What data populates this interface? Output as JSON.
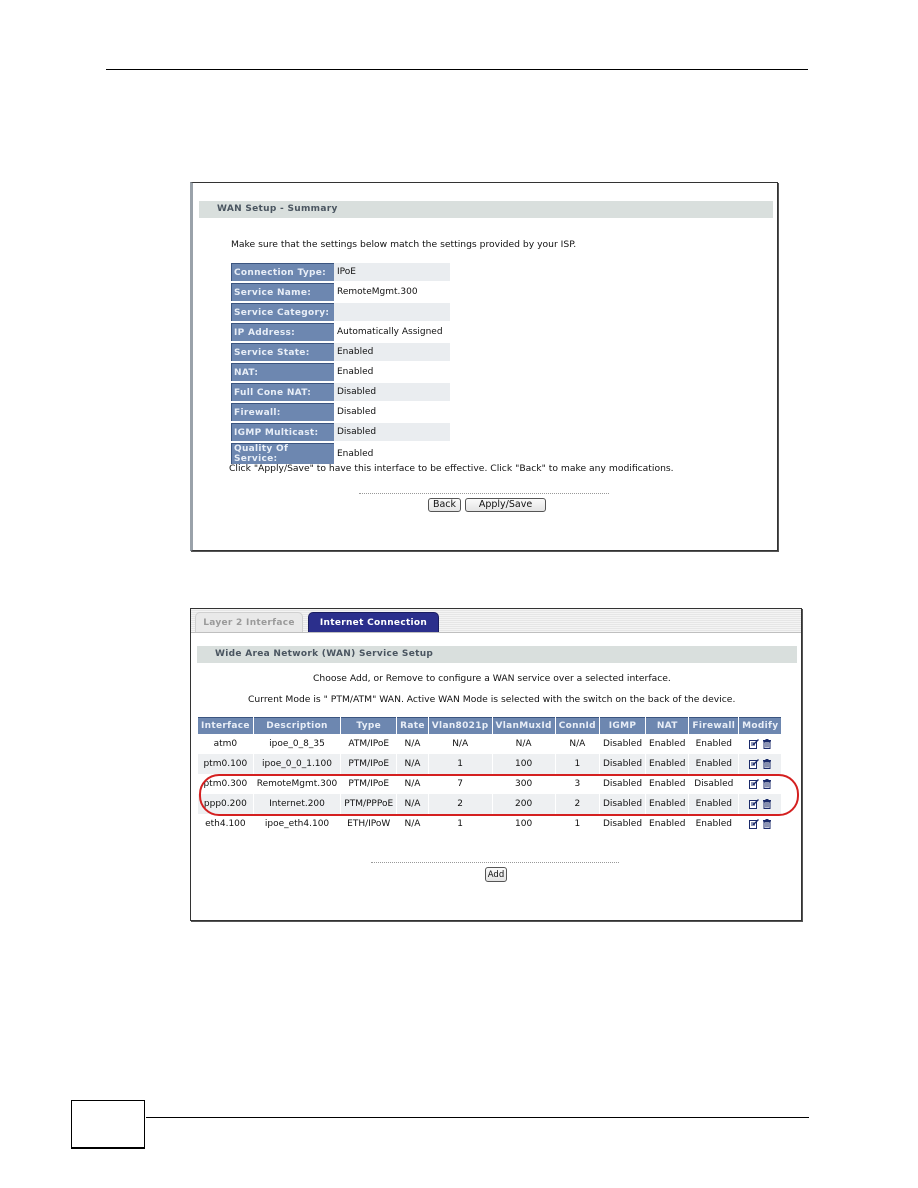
{
  "summary_screen": {
    "section_title": "WAN Setup - Summary",
    "intro": "Make sure that the settings below match the settings provided by your ISP.",
    "rows": [
      {
        "label": "Connection Type:",
        "value": "IPoE"
      },
      {
        "label": "Service Name:",
        "value": "RemoteMgmt.300"
      },
      {
        "label": "Service Category:",
        "value": ""
      },
      {
        "label": "IP Address:",
        "value": "Automatically Assigned"
      },
      {
        "label": "Service State:",
        "value": "Enabled"
      },
      {
        "label": "NAT:",
        "value": "Enabled"
      },
      {
        "label": "Full Cone NAT:",
        "value": "Disabled"
      },
      {
        "label": "Firewall:",
        "value": "Disabled"
      },
      {
        "label": "IGMP Multicast:",
        "value": "Disabled"
      },
      {
        "label": "Quality Of Service:",
        "value": "Enabled"
      }
    ],
    "footer_note": "Click \"Apply/Save\" to have this interface to be effective. Click \"Back\" to make any modifications.",
    "back_label": "Back",
    "apply_label": "Apply/Save"
  },
  "wan_screen": {
    "tabs": [
      {
        "label": "Layer 2 Interface",
        "active": false
      },
      {
        "label": "Internet Connection",
        "active": true
      }
    ],
    "section_title": "Wide Area Network (WAN) Service Setup",
    "line1": "Choose Add, or Remove to configure a WAN service over a selected interface.",
    "line2": "Current Mode is \" PTM/ATM\" WAN. Active WAN Mode is selected with the switch on the back of the device.",
    "columns": [
      "Interface",
      "Description",
      "Type",
      "Rate",
      "Vlan8021p",
      "VlanMuxId",
      "ConnId",
      "IGMP",
      "NAT",
      "Firewall",
      "Modify"
    ],
    "rows": [
      [
        "atm0",
        "ipoe_0_8_35",
        "ATM/IPoE",
        "N/A",
        "N/A",
        "N/A",
        "N/A",
        "Disabled",
        "Enabled",
        "Enabled"
      ],
      [
        "ptm0.100",
        "ipoe_0_0_1.100",
        "PTM/IPoE",
        "N/A",
        "1",
        "100",
        "1",
        "Disabled",
        "Enabled",
        "Enabled"
      ],
      [
        "ptm0.300",
        "RemoteMgmt.300",
        "PTM/IPoE",
        "N/A",
        "7",
        "300",
        "3",
        "Disabled",
        "Enabled",
        "Disabled"
      ],
      [
        "ppp0.200",
        "Internet.200",
        "PTM/PPPoE",
        "N/A",
        "2",
        "200",
        "2",
        "Disabled",
        "Enabled",
        "Enabled"
      ],
      [
        "eth4.100",
        "ipoe_eth4.100",
        "ETH/IPoW",
        "N/A",
        "1",
        "100",
        "1",
        "Disabled",
        "Enabled",
        "Enabled"
      ]
    ],
    "highlighted_rows": [
      "ptm0.300",
      "ppp0.200"
    ],
    "modify_icons": [
      "edit-icon",
      "trash-icon"
    ],
    "add_label": "Add"
  },
  "colors": {
    "header_blue": "#6d87b0",
    "active_tab": "#2b2f8c",
    "section_bar": "#d9dfdd",
    "highlight_red": "#d42020"
  }
}
